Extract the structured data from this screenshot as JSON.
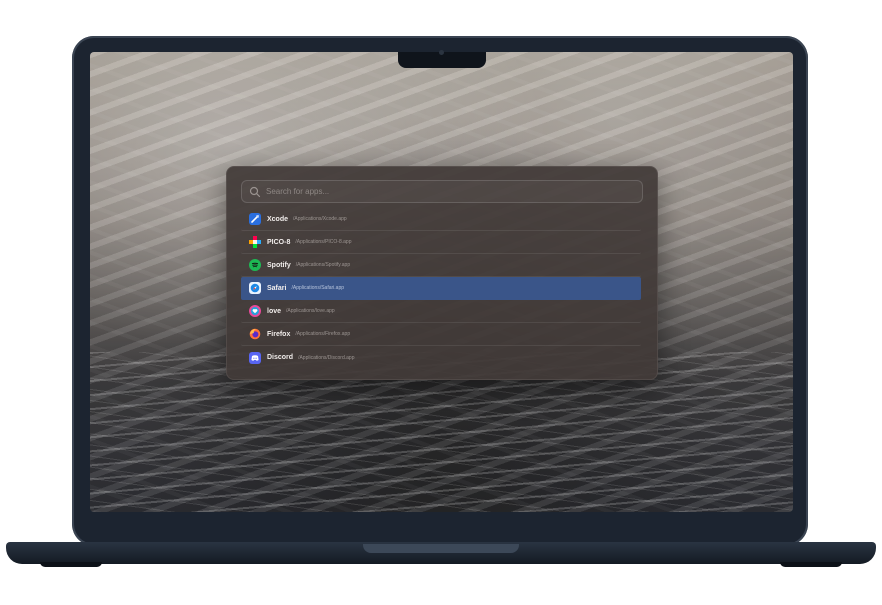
{
  "launcher": {
    "search": {
      "placeholder": "Search for apps..."
    },
    "apps": [
      {
        "name": "Xcode",
        "path": "/Applications/Xcode.app",
        "icon": "xcode-icon",
        "color": "#2a6fe0"
      },
      {
        "name": "PICO-8",
        "path": "/Applications/PICO-8.app",
        "icon": "pico8-icon",
        "color": "#ff004d"
      },
      {
        "name": "Spotify",
        "path": "/Applications/Spotify.app",
        "icon": "spotify-icon",
        "color": "#1db954"
      },
      {
        "name": "Safari",
        "path": "/Applications/Safari.app",
        "icon": "safari-icon",
        "color": "#1e88e5",
        "selected": true
      },
      {
        "name": "love",
        "path": "/Applications/love.app",
        "icon": "love-icon",
        "color": "#e74a99"
      },
      {
        "name": "Firefox",
        "path": "/Applications/Firefox.app",
        "icon": "firefox-icon",
        "color": "#ff7139"
      },
      {
        "name": "Discord",
        "path": "/Applications/Discord.app",
        "icon": "discord-icon",
        "color": "#5865f2"
      }
    ]
  },
  "colors": {
    "selection": "#3a5589",
    "panel": "#423a38",
    "laptop": "#1c2430"
  }
}
